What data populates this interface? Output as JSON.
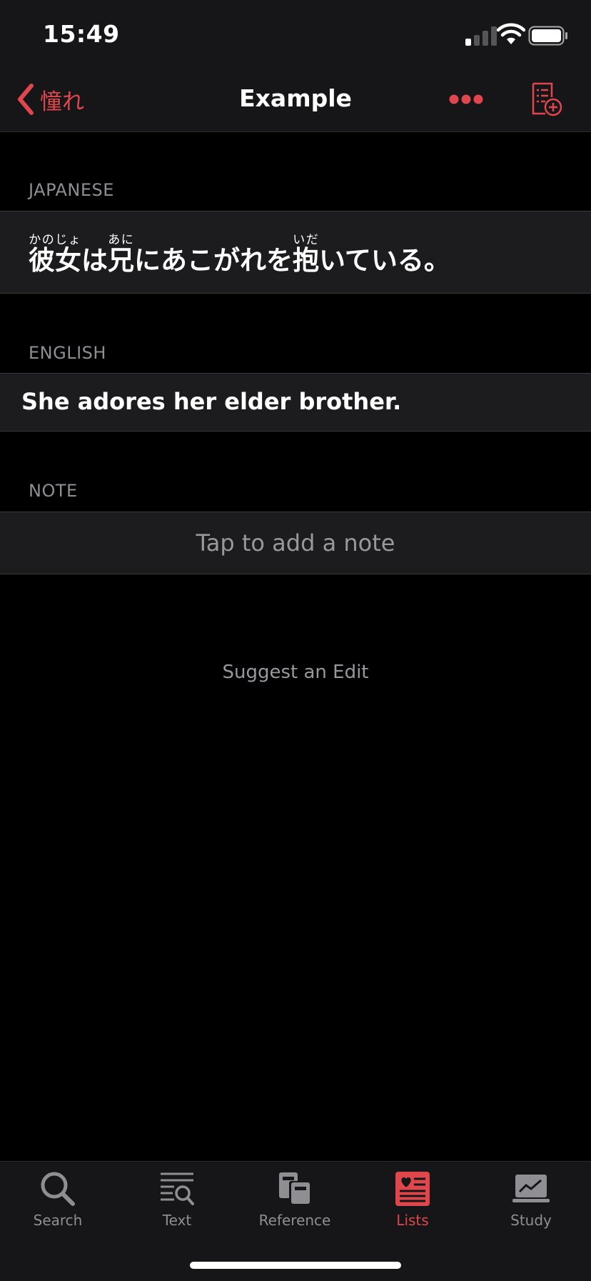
{
  "status": {
    "time": "15:49"
  },
  "nav": {
    "back_label": "憧れ",
    "title": "Example"
  },
  "sections": {
    "japanese": {
      "header": "JAPANESE",
      "sentence": [
        {
          "text": "彼女",
          "reading": "かのじょ"
        },
        {
          "text": "は"
        },
        {
          "text": "兄",
          "reading": "あに"
        },
        {
          "text": "にあこがれを"
        },
        {
          "text": "抱",
          "reading": "いだ"
        },
        {
          "text": "いている。"
        }
      ]
    },
    "english": {
      "header": "ENGLISH",
      "sentence": "She adores her elder brother."
    },
    "note": {
      "header": "NOTE",
      "placeholder": "Tap to add a note"
    }
  },
  "suggest_edit": "Suggest an Edit",
  "tabbar": {
    "active": "lists",
    "tabs": [
      {
        "id": "search",
        "label": "Search",
        "icon": "magnifier-icon"
      },
      {
        "id": "text",
        "label": "Text",
        "icon": "text-search-icon"
      },
      {
        "id": "reference",
        "label": "Reference",
        "icon": "books-icon"
      },
      {
        "id": "lists",
        "label": "Lists",
        "icon": "heart-list-icon"
      },
      {
        "id": "study",
        "label": "Study",
        "icon": "chart-laptop-icon"
      }
    ]
  },
  "colors": {
    "accent": "#e0474d",
    "background": "#000000",
    "bar": "#161618",
    "cell": "#1c1c1e",
    "secondary_text": "#8e8e93"
  }
}
